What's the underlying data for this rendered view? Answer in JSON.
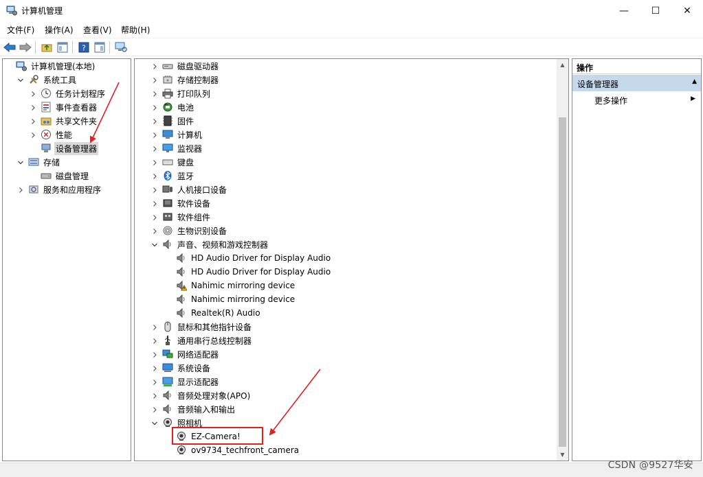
{
  "window": {
    "title": "计算机管理",
    "controls": {
      "minimize": "—",
      "maximize": "☐",
      "close": "✕"
    }
  },
  "menu": [
    "文件(F)",
    "操作(A)",
    "查看(V)",
    "帮助(H)"
  ],
  "left_tree": [
    {
      "label": "计算机管理(本地)",
      "icon": "computer-management-icon",
      "level": 0,
      "expander": "none"
    },
    {
      "label": "系统工具",
      "icon": "tools-icon",
      "level": 1,
      "expander": "expanded"
    },
    {
      "label": "任务计划程序",
      "icon": "clock-icon",
      "level": 2,
      "expander": "collapsed"
    },
    {
      "label": "事件查看器",
      "icon": "event-viewer-icon",
      "level": 2,
      "expander": "collapsed"
    },
    {
      "label": "共享文件夹",
      "icon": "shared-folder-icon",
      "level": 2,
      "expander": "collapsed"
    },
    {
      "label": "性能",
      "icon": "performance-icon",
      "level": 2,
      "expander": "collapsed"
    },
    {
      "label": "设备管理器",
      "icon": "device-manager-icon",
      "level": 2,
      "expander": "none",
      "selected": true
    },
    {
      "label": "存储",
      "icon": "storage-icon",
      "level": 1,
      "expander": "expanded"
    },
    {
      "label": "磁盘管理",
      "icon": "disk-icon",
      "level": 2,
      "expander": "none"
    },
    {
      "label": "服务和应用程序",
      "icon": "services-icon",
      "level": 1,
      "expander": "collapsed"
    }
  ],
  "device_tree": [
    {
      "label": "磁盘驱动器",
      "icon": "disk-drive-icon",
      "level": 0,
      "expander": "collapsed"
    },
    {
      "label": "存储控制器",
      "icon": "storage-controller-icon",
      "level": 0,
      "expander": "collapsed"
    },
    {
      "label": "打印队列",
      "icon": "printer-icon",
      "level": 0,
      "expander": "collapsed"
    },
    {
      "label": "电池",
      "icon": "battery-icon",
      "level": 0,
      "expander": "collapsed"
    },
    {
      "label": "固件",
      "icon": "firmware-icon",
      "level": 0,
      "expander": "collapsed"
    },
    {
      "label": "计算机",
      "icon": "computer-icon",
      "level": 0,
      "expander": "collapsed"
    },
    {
      "label": "监视器",
      "icon": "monitor-icon",
      "level": 0,
      "expander": "collapsed"
    },
    {
      "label": "键盘",
      "icon": "keyboard-icon",
      "level": 0,
      "expander": "collapsed"
    },
    {
      "label": "蓝牙",
      "icon": "bluetooth-icon",
      "level": 0,
      "expander": "collapsed"
    },
    {
      "label": "人机接口设备",
      "icon": "hid-icon",
      "level": 0,
      "expander": "collapsed"
    },
    {
      "label": "软件设备",
      "icon": "software-device-icon",
      "level": 0,
      "expander": "collapsed"
    },
    {
      "label": "软件组件",
      "icon": "software-component-icon",
      "level": 0,
      "expander": "collapsed"
    },
    {
      "label": "生物识别设备",
      "icon": "fingerprint-icon",
      "level": 0,
      "expander": "collapsed"
    },
    {
      "label": "声音、视频和游戏控制器",
      "icon": "speaker-icon",
      "level": 0,
      "expander": "expanded"
    },
    {
      "label": "HD Audio Driver for Display Audio",
      "icon": "speaker-icon",
      "level": 1,
      "expander": "none"
    },
    {
      "label": "HD Audio Driver for Display Audio",
      "icon": "speaker-icon",
      "level": 1,
      "expander": "none"
    },
    {
      "label": "Nahimic mirroring device",
      "icon": "speaker-warning-icon",
      "level": 1,
      "expander": "none"
    },
    {
      "label": "Nahimic mirroring device",
      "icon": "speaker-icon",
      "level": 1,
      "expander": "none"
    },
    {
      "label": "Realtek(R) Audio",
      "icon": "speaker-icon",
      "level": 1,
      "expander": "none"
    },
    {
      "label": "鼠标和其他指针设备",
      "icon": "mouse-icon",
      "level": 0,
      "expander": "collapsed"
    },
    {
      "label": "通用串行总线控制器",
      "icon": "usb-icon",
      "level": 0,
      "expander": "collapsed"
    },
    {
      "label": "网络适配器",
      "icon": "network-adapter-icon",
      "level": 0,
      "expander": "collapsed"
    },
    {
      "label": "系统设备",
      "icon": "system-device-icon",
      "level": 0,
      "expander": "collapsed"
    },
    {
      "label": "显示适配器",
      "icon": "display-adapter-icon",
      "level": 0,
      "expander": "collapsed"
    },
    {
      "label": "音频处理对象(APO)",
      "icon": "speaker-icon",
      "level": 0,
      "expander": "collapsed"
    },
    {
      "label": "音频输入和输出",
      "icon": "speaker-icon",
      "level": 0,
      "expander": "collapsed"
    },
    {
      "label": "照相机",
      "icon": "camera-icon",
      "level": 0,
      "expander": "expanded"
    },
    {
      "label": "EZ-Camera!",
      "icon": "camera-icon",
      "level": 1,
      "expander": "none",
      "highlighted": true
    },
    {
      "label": "ov9734_techfront_camera",
      "icon": "camera-icon",
      "level": 1,
      "expander": "none"
    }
  ],
  "actions": {
    "header": "操作",
    "section": "设备管理器",
    "section_arrow": "▲",
    "item": "更多操作",
    "item_arrow": "▶"
  },
  "watermark": "CSDN @9527华安",
  "colors": {
    "annotation_red": "#e02020",
    "selected_section": "#c5d9ea"
  }
}
